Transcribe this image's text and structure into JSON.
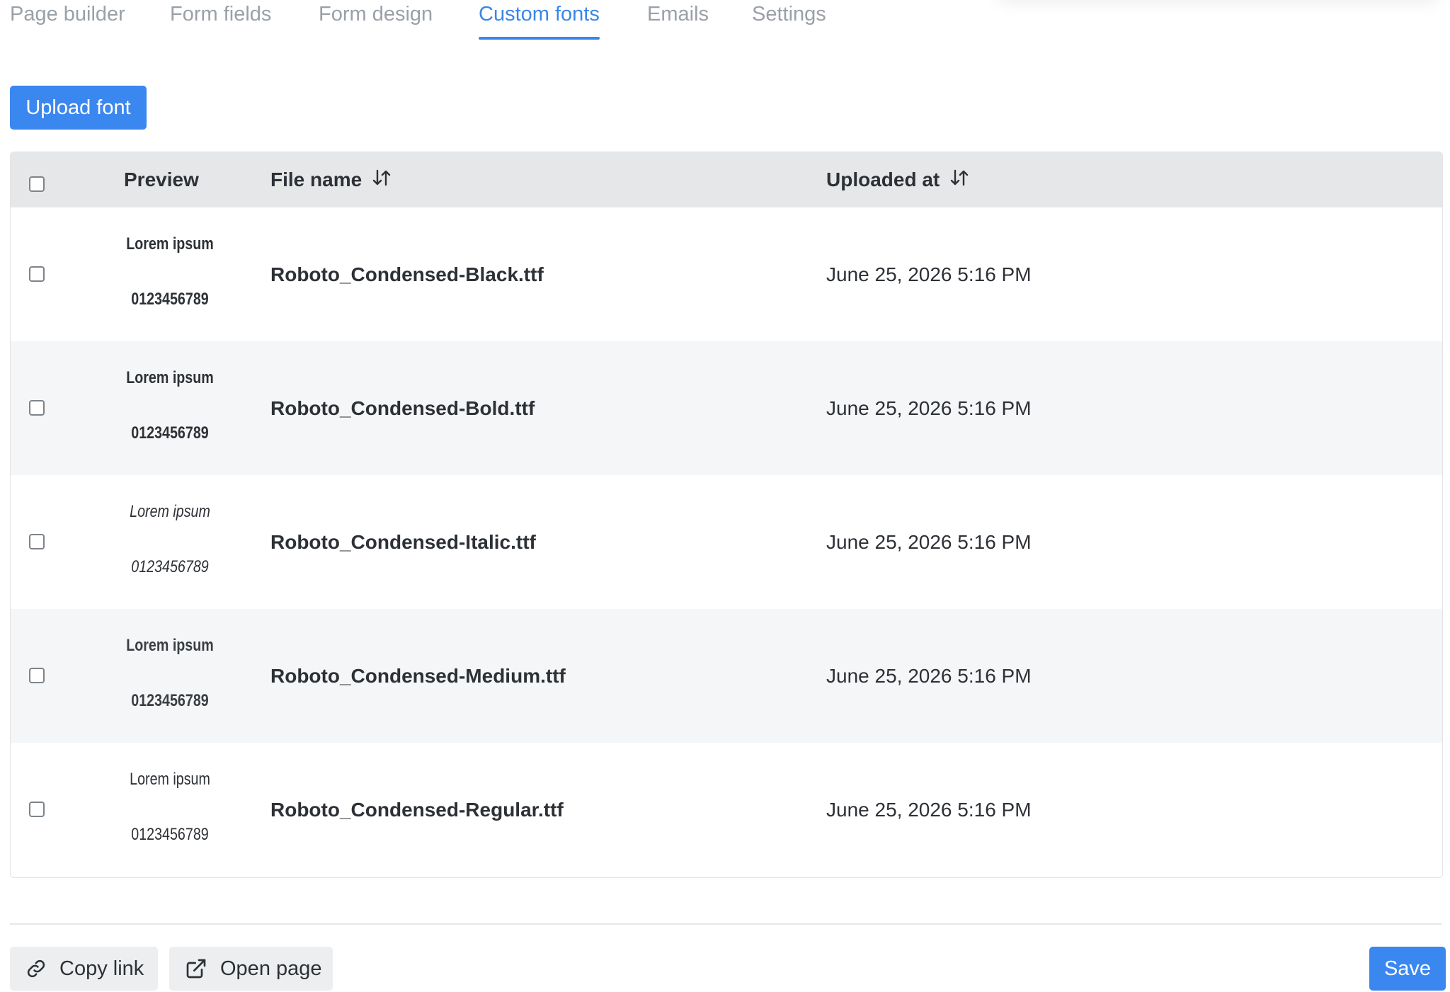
{
  "tabs": [
    {
      "label": "Page builder",
      "active": false
    },
    {
      "label": "Form fields",
      "active": false
    },
    {
      "label": "Form design",
      "active": false
    },
    {
      "label": "Custom fonts",
      "active": true
    },
    {
      "label": "Emails",
      "active": false
    },
    {
      "label": "Settings",
      "active": false
    }
  ],
  "upload_button": "Upload font",
  "table": {
    "headers": {
      "preview": "Preview",
      "file_name": "File name",
      "uploaded_at": "Uploaded at"
    },
    "rows": [
      {
        "preview_text": "Lorem ipsum",
        "preview_digits": "0123456789",
        "file_name": "Roboto_Condensed-Black.ttf",
        "uploaded_at": "June 25, 2026 5:16 PM",
        "checked": false
      },
      {
        "preview_text": "Lorem ipsum",
        "preview_digits": "0123456789",
        "file_name": "Roboto_Condensed-Bold.ttf",
        "uploaded_at": "June 25, 2026 5:16 PM",
        "checked": false
      },
      {
        "preview_text": "Lorem ipsum",
        "preview_digits": "0123456789",
        "file_name": "Roboto_Condensed-Italic.ttf",
        "uploaded_at": "June 25, 2026 5:16 PM",
        "checked": false
      },
      {
        "preview_text": "Lorem ipsum",
        "preview_digits": "0123456789",
        "file_name": "Roboto_Condensed-Medium.ttf",
        "uploaded_at": "June 25, 2026 5:16 PM",
        "checked": false
      },
      {
        "preview_text": "Lorem ipsum",
        "preview_digits": "0123456789",
        "file_name": "Roboto_Condensed-Regular.ttf",
        "uploaded_at": "June 25, 2026 5:16 PM",
        "checked": false
      }
    ]
  },
  "footer": {
    "copy_link": "Copy link",
    "open_page": "Open page",
    "save": "Save"
  },
  "colors": {
    "accent": "#3b87f0",
    "header_bg": "#e6e7e9",
    "alt_row_bg": "#f5f6f7",
    "inactive_tab": "#9aa0a7"
  }
}
